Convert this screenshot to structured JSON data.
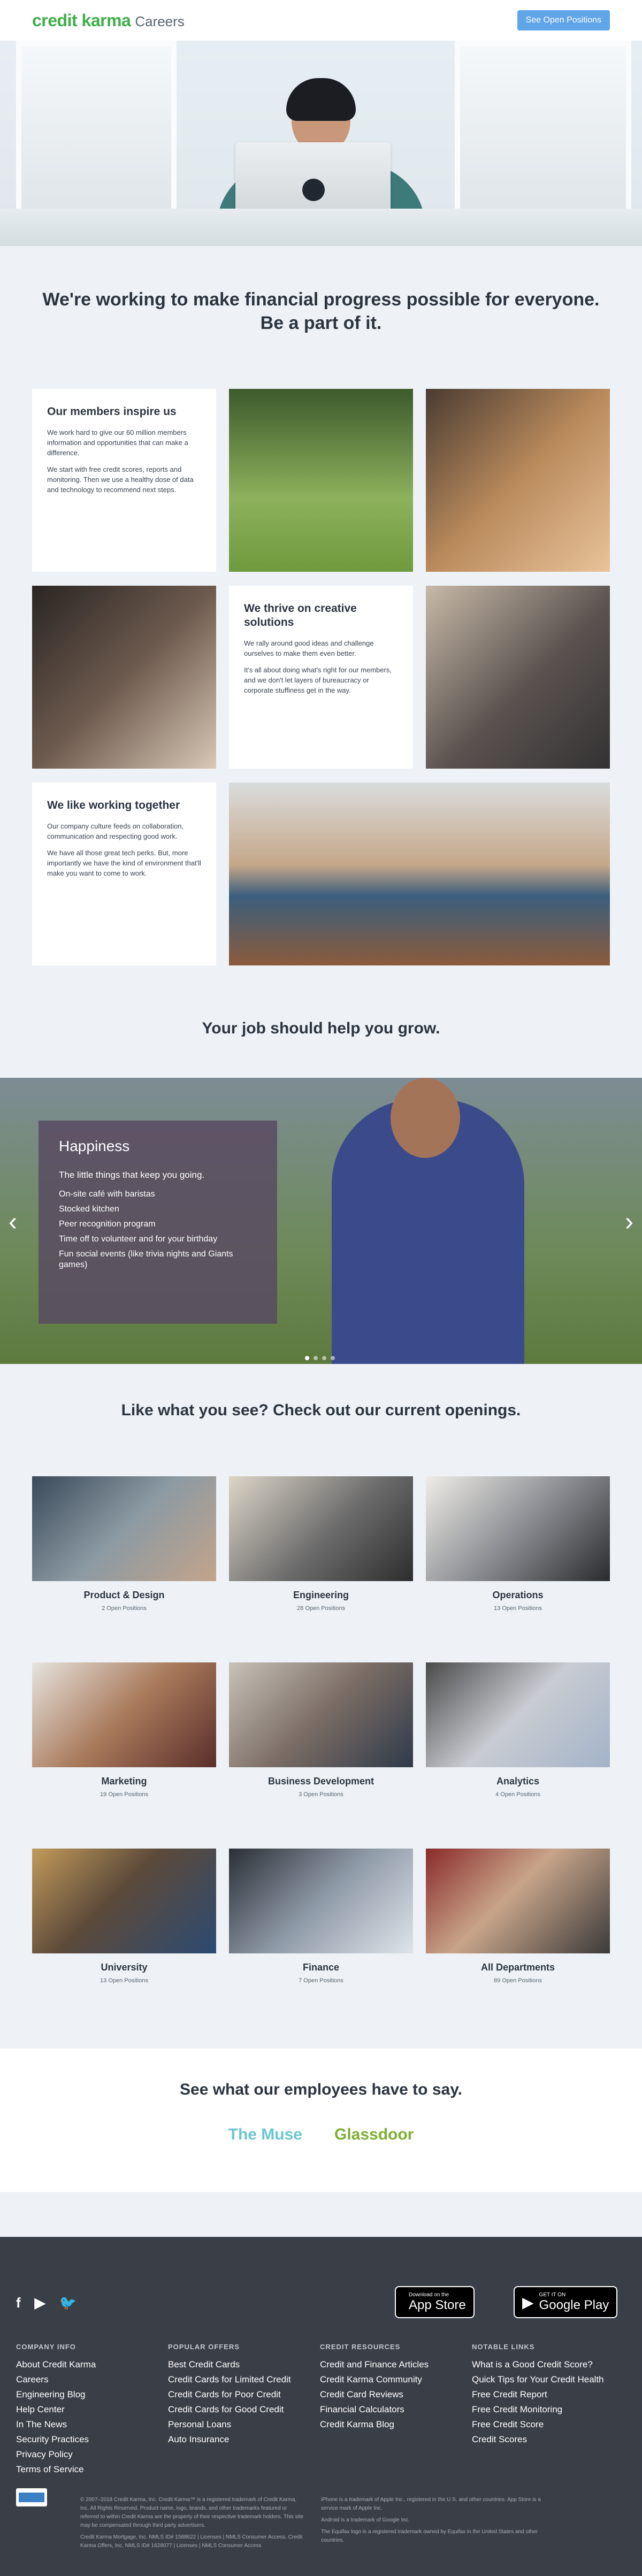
{
  "header": {
    "logo": "credit karma",
    "subtitle": "Careers",
    "cta_label": "See Open Positions"
  },
  "mission": {
    "line1": "We're working to make financial progress possible for everyone.",
    "line2": "Be a part of it."
  },
  "culture": [
    {
      "title": "Our members inspire us",
      "paragraphs": [
        "We work hard to give our 60 million members information and opportunities that can make a difference.",
        "We start with free credit scores, reports and monitoring. Then we use a healthy dose of data and technology to recommend next steps."
      ]
    },
    {
      "title": "We thrive on creative solutions",
      "paragraphs": [
        "We rally around good ideas and challenge ourselves to make them even better.",
        "It's all about doing what's right for our members, and we don't let layers of bureaucracy or corporate stuffiness get in the way."
      ]
    },
    {
      "title": "We like working together",
      "paragraphs": [
        "Our company culture feeds on collaboration, communication and respecting good work.",
        "We have all those great tech perks. But, more importantly we have the kind of environment that'll make you want to come to work."
      ]
    }
  ],
  "grow": {
    "title": "Your job should help you grow."
  },
  "carousel": {
    "heading": "Happiness",
    "tagline": "The little things that keep you going.",
    "items": [
      "On-site café with baristas",
      "Stocked kitchen",
      "Peer recognition program",
      "Time off to volunteer and for your birthday",
      "Fun social events (like trivia nights and Giants games)"
    ],
    "prev": "‹",
    "next": "›"
  },
  "openings": {
    "title": "Like what you see? Check out our current openings."
  },
  "departments": [
    {
      "name": "Product & Design",
      "count": "2 Open Positions"
    },
    {
      "name": "Engineering",
      "count": "28 Open Positions"
    },
    {
      "name": "Operations",
      "count": "13 Open Positions"
    },
    {
      "name": "Marketing",
      "count": "19 Open Positions"
    },
    {
      "name": "Business Development",
      "count": "3 Open Positions"
    },
    {
      "name": "Analytics",
      "count": "4 Open Positions"
    },
    {
      "name": "University",
      "count": "13 Open Positions"
    },
    {
      "name": "Finance",
      "count": "7 Open Positions"
    },
    {
      "name": "All Departments",
      "count": "89 Open Positions"
    }
  ],
  "employees": {
    "title": "See what our employees have to say.",
    "muse": "The Muse",
    "glassdoor": "Glassdoor"
  },
  "footer": {
    "social": {
      "facebook": "f",
      "youtube": "▶",
      "twitter": "🐦"
    },
    "app_store": {
      "small": "Download on the",
      "big": "App Store"
    },
    "google_play": {
      "small": "GET IT ON",
      "big": "Google Play"
    },
    "columns": [
      {
        "title": "COMPANY INFO",
        "links": [
          "About Credit Karma",
          "Careers",
          "Engineering Blog",
          "Help Center",
          "In The News",
          "Security Practices",
          "Privacy Policy",
          "Terms of Service"
        ]
      },
      {
        "title": "POPULAR OFFERS",
        "links": [
          "Best Credit Cards",
          "Credit Cards for Limited Credit",
          "Credit Cards for Poor Credit",
          "Credit Cards for Good Credit",
          "Personal Loans",
          "Auto Insurance"
        ]
      },
      {
        "title": "CREDIT RESOURCES",
        "links": [
          "Credit and Finance Articles",
          "Credit Karma Community",
          "Credit Card Reviews",
          "Financial Calculators",
          "Credit Karma Blog"
        ]
      },
      {
        "title": "NOTABLE LINKS",
        "links": [
          "What is a Good Credit Score?",
          "Quick Tips for Your Credit Health",
          "Free Credit Report",
          "Free Credit Monitoring",
          "Free Credit Score",
          "Credit Scores"
        ]
      }
    ],
    "legal_left": "© 2007–2018 Credit Karma, Inc. Credit Karma™ is a registered trademark of Credit Karma, Inc. All Rights Reserved. Product name, logo, brands, and other trademarks featured or referred to within Credit Karma are the property of their respective trademark holders. This site may be compensated through third party advertisers.",
    "legal_left2": "Credit Karma Mortgage, Inc. NMLS ID# 1588622 | Licenses | NMLS Consumer Access. Credit Karma Offers, Inc. NMLS ID# 1628077 | Licenses | NMLS Consumer Access",
    "legal_right": "iPhone is a trademark of Apple Inc., registered in the U.S. and other countries. App Store is a service mark of Apple Inc.",
    "legal_right2": "Android is a trademark of Google Inc.",
    "legal_right3": "The Equifax logo is a registered trademark owned by Equifax in the United States and other countries."
  }
}
